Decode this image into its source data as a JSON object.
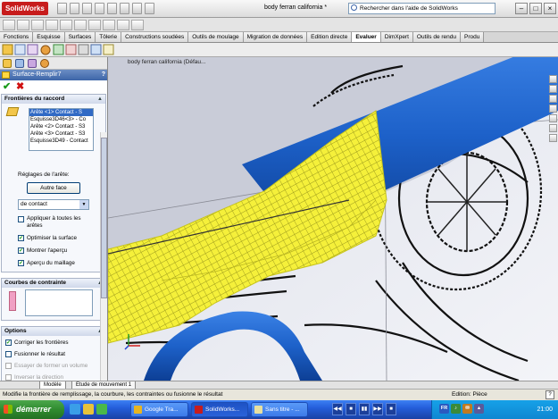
{
  "app": {
    "logo_text": "SolidWorks",
    "document_title": "body ferran california *",
    "search_placeholder": "Rechercher dans l'aide de SolidWorks"
  },
  "window_controls": [
    "–",
    "□",
    "×"
  ],
  "tabs": [
    {
      "label": "Fonctions",
      "active": false
    },
    {
      "label": "Esquisse",
      "active": false
    },
    {
      "label": "Surfaces",
      "active": false
    },
    {
      "label": "Tôlerie",
      "active": false
    },
    {
      "label": "Constructions soudées",
      "active": false
    },
    {
      "label": "Outils de moulage",
      "active": false
    },
    {
      "label": "Migration de données",
      "active": false
    },
    {
      "label": "Edition directe",
      "active": false
    },
    {
      "label": "Evaluer",
      "active": true
    },
    {
      "label": "DimXpert",
      "active": false
    },
    {
      "label": "Outils de rendu",
      "active": false
    },
    {
      "label": "Produ",
      "active": false
    }
  ],
  "property_manager": {
    "title": "Surface-Remplir7",
    "help": "?",
    "ok": "✔",
    "cancel": "✖",
    "boundary_section": {
      "title": "Frontières du raccord",
      "items": [
        {
          "label": "Arête <1> Contact - S",
          "selected": true
        },
        {
          "label": "Esquisse3D46<3> - Co",
          "selected": false
        },
        {
          "label": "Arête <2> Contact - S3",
          "selected": false
        },
        {
          "label": "Arête <3> Contact - S3",
          "selected": false
        },
        {
          "label": "Esquisse3D49 - Contact",
          "selected": false
        }
      ],
      "edge_settings_label": "Réglages de l'arête:",
      "other_face_button": "Autre face",
      "contact_select": "de contact",
      "apply_all_label": "Appliquer à toutes les arêtes",
      "apply_all_checked": false,
      "optimize_label": "Optimiser la surface",
      "optimize_checked": true,
      "show_preview_label": "Montrer l'aperçu",
      "show_preview_checked": true,
      "mesh_preview_label": "Aperçu du maillage",
      "mesh_preview_checked": true
    },
    "constraint_section": {
      "title": "Courbes de contrainte"
    },
    "options_section": {
      "title": "Options",
      "fix_boundaries_label": "Corriger les frontières",
      "fix_boundaries_checked": true,
      "merge_result_label": "Fusionner le résultat",
      "merge_result_checked": false,
      "try_solid_label": "Essayer de former un volume",
      "try_solid_checked": false,
      "reverse_direction_label": "Inverser la direction",
      "reverse_direction_checked": false
    }
  },
  "viewport": {
    "breadcrumb": "body ferran california (Défau..."
  },
  "model_tabs": [
    {
      "label": "Modèle",
      "active": true
    },
    {
      "label": "Etude de mouvement 1",
      "active": false
    }
  ],
  "status": {
    "message": "Modifie la frontière de remplissage, la courbure, les contraintes ou fusionne le résultat",
    "mode": "Edition: Pièce",
    "help": "?"
  },
  "taskbar": {
    "start_label": "démarrer",
    "tasks": [
      {
        "label": "Google Tra...",
        "active": false,
        "icon_color": "#e8b520"
      },
      {
        "label": "SolidWorks...",
        "active": true,
        "icon_color": "#c71c1c"
      },
      {
        "label": "Sans titre - ...",
        "active": false,
        "icon_color": "#e8e0a0"
      }
    ],
    "media_buttons": [
      "◀◀",
      "■",
      "▮▮",
      "▶▶",
      "■"
    ],
    "tray_badges": [
      "FR",
      "♪",
      "✉",
      "▲"
    ],
    "clock": "21:00"
  },
  "colors": {
    "accent_blue": "#1d61c9",
    "surface_yellow": "#f5f03a",
    "header_blue": "#3d65a8"
  }
}
